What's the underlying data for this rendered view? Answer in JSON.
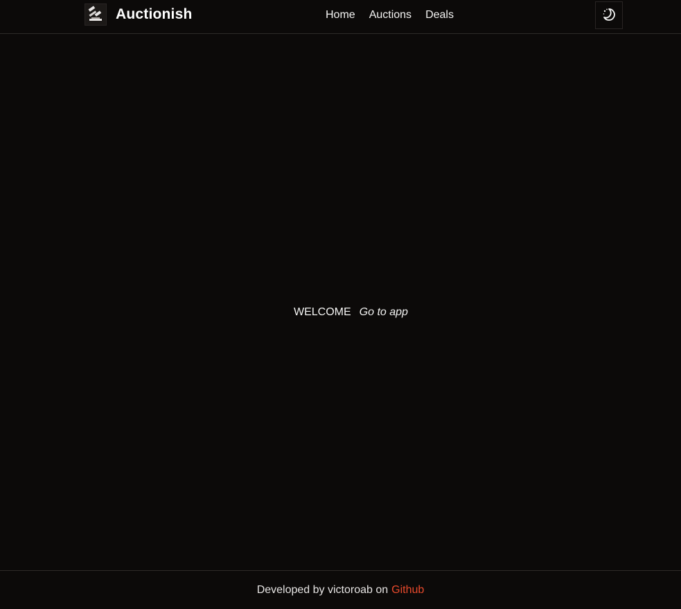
{
  "header": {
    "brand": "Auctionish",
    "logo_icon": "gavel-icon",
    "nav": [
      {
        "label": "Home"
      },
      {
        "label": "Auctions"
      },
      {
        "label": "Deals"
      }
    ],
    "theme_toggle_icon": "moon-stars-icon"
  },
  "main": {
    "welcome": "WELCOME",
    "go_to_app": "Go to app"
  },
  "footer": {
    "text": "Developed by victoroab on",
    "link_label": "Github",
    "link_color": "#ea4a2c"
  },
  "colors": {
    "background": "#0c0a09",
    "border": "#2e2b29",
    "text": "#f5f5f4"
  }
}
